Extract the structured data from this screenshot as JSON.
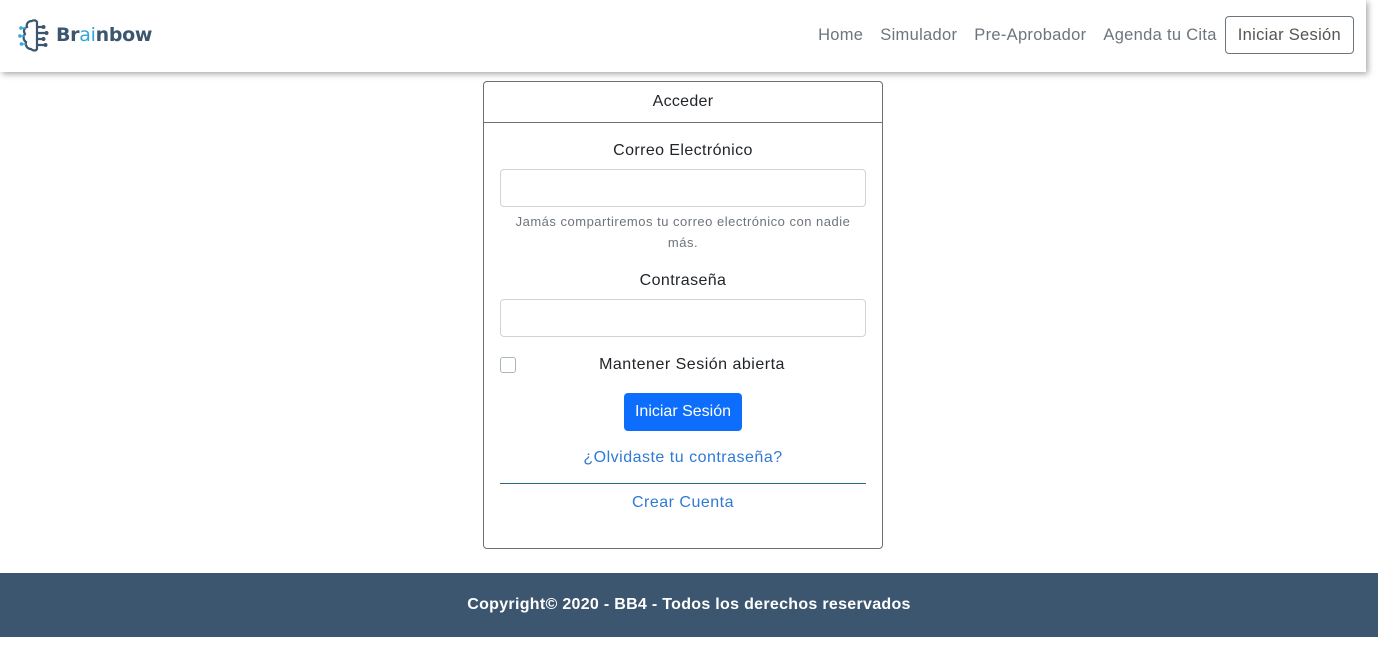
{
  "brand": {
    "prefix": "Br",
    "highlight": "ai",
    "suffix": "nbow",
    "logo_icon": "brain-circuit-icon"
  },
  "nav": {
    "links": [
      "Home",
      "Simulador",
      "Pre-Aprobador",
      "Agenda tu Cita"
    ],
    "login_label": "Iniciar Sesión"
  },
  "login_card": {
    "header": "Acceder",
    "email_label": "Correo Electrónico",
    "email_value": "",
    "email_help": "Jamás compartiremos tu correo electrónico con nadie más.",
    "password_label": "Contraseña",
    "password_value": "",
    "remember_label": "Mantener Sesión abierta",
    "submit_label": "Iniciar Sesión",
    "forgot_link": "¿Olvidaste tu contraseña?",
    "create_link": "Crear Cuenta"
  },
  "footer": {
    "text": "Copyright© 2020 - BB4 - Todos los derechos reservados"
  },
  "colors": {
    "brand_dark": "#3d5670",
    "brand_accent": "#2fa7d9",
    "primary": "#0d6efd",
    "link": "#2e7ad6",
    "footer_bg": "#3d5670"
  }
}
